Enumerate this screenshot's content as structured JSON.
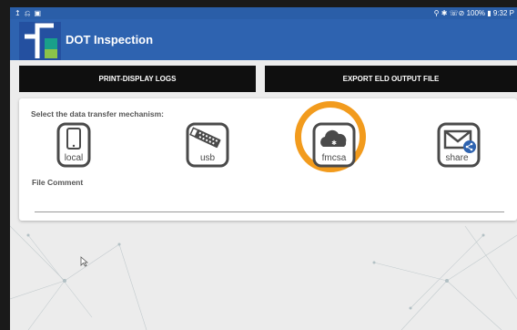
{
  "status_bar": {
    "left_icons": "↥ ⎌ ▣",
    "right_text": "⚲ ✱ ☏⊘ 100% ▮ 9:32 P"
  },
  "app": {
    "title": "DOT Inspection",
    "logo_icon": "dot-logo-icon"
  },
  "toolbar": {
    "print_label": "PRINT-DISPLAY LOGS",
    "export_label": "EXPORT ELD OUTPUT FILE"
  },
  "transfer": {
    "prompt": "Select the data transfer mechanism:",
    "options": [
      {
        "id": "local",
        "label": "local",
        "icon": "phone-icon"
      },
      {
        "id": "usb",
        "label": "usb",
        "icon": "usb-drive-icon"
      },
      {
        "id": "fmcsa",
        "label": "fmcsa",
        "icon": "cloud-icon",
        "selected": true
      },
      {
        "id": "share",
        "label": "share",
        "icon": "envelope-share-icon"
      }
    ]
  },
  "comment": {
    "label": "File Comment",
    "value": "",
    "placeholder": ""
  },
  "colors": {
    "app_bar": "#2e63b0",
    "status_bar": "#2a5ea8",
    "button_bg": "#0f0f0f",
    "highlight": "#f29b1d",
    "logo_teal": "#19a08a",
    "logo_green": "#8bc34a"
  }
}
